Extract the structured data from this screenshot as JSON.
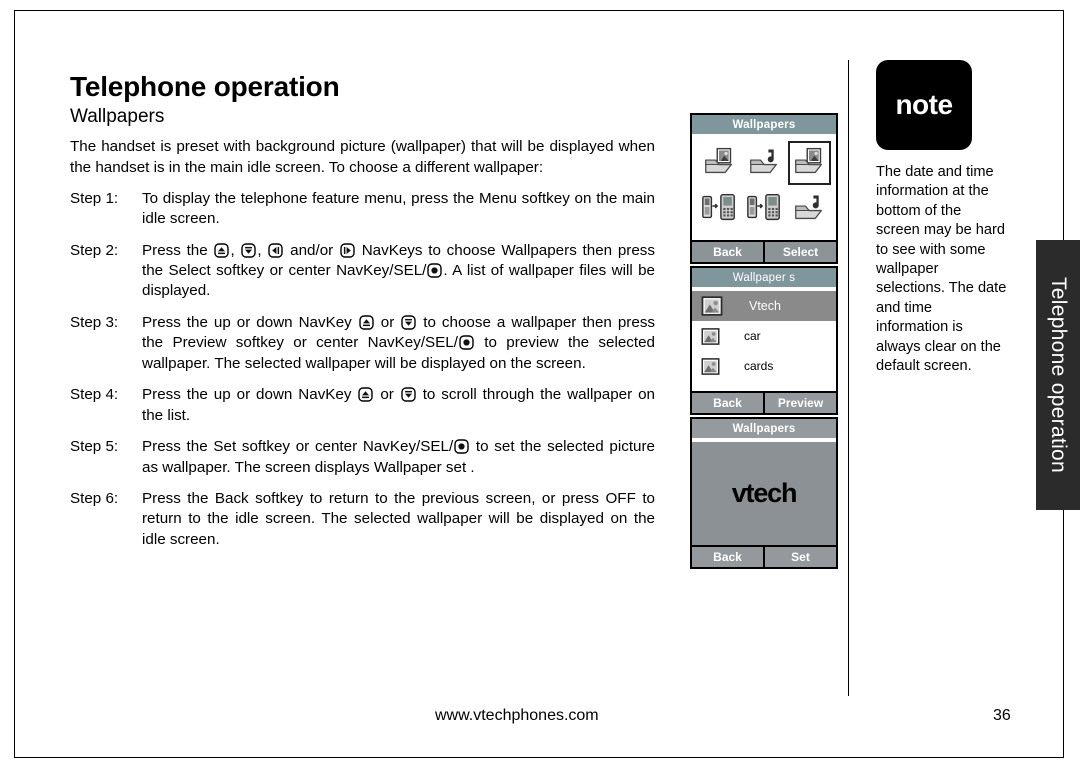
{
  "page": {
    "title": "Telephone operation",
    "section": "Wallpapers",
    "intro": "The handset is preset with background picture (wallpaper) that will be displayed when the handset is in the main idle screen. To choose a different wallpaper:",
    "steps": [
      {
        "label": "Step 1:",
        "parts": [
          {
            "t": "text",
            "v": "To display the telephone feature menu, press the Menu softkey on the main idle screen."
          }
        ]
      },
      {
        "label": "Step 2:",
        "parts": [
          {
            "t": "text",
            "v": "Press the "
          },
          {
            "t": "icon",
            "v": "navkey-up-icon"
          },
          {
            "t": "text",
            "v": ", "
          },
          {
            "t": "icon",
            "v": "navkey-down-icon"
          },
          {
            "t": "text",
            "v": ", "
          },
          {
            "t": "icon",
            "v": "navkey-left-icon"
          },
          {
            "t": "text",
            "v": " and/or "
          },
          {
            "t": "icon",
            "v": "navkey-right-icon"
          },
          {
            "t": "text",
            "v": " NavKeys to choose Wallpapers then press the Select softkey or center NavKey/SEL/"
          },
          {
            "t": "icon",
            "v": "navkey-select-icon"
          },
          {
            "t": "text",
            "v": ". A list of wallpaper files will be displayed."
          }
        ]
      },
      {
        "label": "Step 3:",
        "parts": [
          {
            "t": "text",
            "v": "Press the up or down NavKey "
          },
          {
            "t": "icon",
            "v": "navkey-up-icon"
          },
          {
            "t": "text",
            "v": " or "
          },
          {
            "t": "icon",
            "v": "navkey-down-icon"
          },
          {
            "t": "text",
            "v": " to choose a wallpaper then press the Preview softkey or center NavKey/SEL/"
          },
          {
            "t": "icon",
            "v": "navkey-select-icon"
          },
          {
            "t": "text",
            "v": " to preview the selected wallpaper. The selected wallpaper will be displayed on the screen."
          }
        ]
      },
      {
        "label": "Step 4:",
        "parts": [
          {
            "t": "text",
            "v": "Press the up or down NavKey "
          },
          {
            "t": "icon",
            "v": "navkey-up-icon"
          },
          {
            "t": "text",
            "v": " or "
          },
          {
            "t": "icon",
            "v": "navkey-down-icon"
          },
          {
            "t": "text",
            "v": " to scroll through the wallpaper on the list."
          }
        ]
      },
      {
        "label": "Step 5:",
        "parts": [
          {
            "t": "text",
            "v": "Press the Set softkey or center NavKey/SEL/"
          },
          {
            "t": "icon",
            "v": "navkey-select-icon"
          },
          {
            "t": "text",
            "v": " to set the selected picture as wallpaper. The screen displays Wallpaper set ."
          }
        ]
      },
      {
        "label": "Step 6:",
        "parts": [
          {
            "t": "text",
            "v": "Press the Back softkey to return to the previous screen, or press OFF to return to the idle screen. The selected wallpaper will be displayed on the idle screen."
          }
        ]
      }
    ]
  },
  "screens": [
    {
      "id": "wallpaper-grid",
      "header": "Wallpapers",
      "type": "icon-grid",
      "cells": [
        {
          "icon": "folder-photo-icon",
          "selected": false
        },
        {
          "icon": "folder-music-icon",
          "selected": false
        },
        {
          "icon": "folder-photo-icon",
          "selected": true
        },
        {
          "icon": "basestation-handset-icon",
          "selected": false
        },
        {
          "icon": "basestation-handset-icon",
          "selected": false
        },
        {
          "icon": "folder-music-icon",
          "selected": false
        }
      ],
      "softkeys": [
        "Back",
        "Select"
      ]
    },
    {
      "id": "wallpaper-list",
      "header": "Wallpaper s",
      "type": "list",
      "rows": [
        {
          "icon": "picture-icon",
          "label": "Vtech",
          "selected": true
        },
        {
          "icon": "picture-icon",
          "label": "car",
          "selected": false
        },
        {
          "icon": "picture-icon",
          "label": "cards",
          "selected": false
        }
      ],
      "softkeys": [
        "Back",
        "Preview"
      ]
    },
    {
      "id": "wallpaper-preview",
      "header": "Wallpapers",
      "type": "preview",
      "preview_text": "vtech",
      "softkeys": [
        "Back",
        "Set"
      ]
    }
  ],
  "note": {
    "badge": "note",
    "text": "The date and time information at the bottom of the screen may be hard to see with some wallpaper selections. The date and time information is always clear on the default screen."
  },
  "side_tab": {
    "label": "Telephone operation"
  },
  "footer": {
    "url": "www.vtechphones.com",
    "page_number": "36"
  },
  "colors": {
    "header_teal": "#7e969c",
    "softkey_gray": "#8d9497",
    "list_selected": "#8a8a8a",
    "preview_bg": "#8b9194",
    "side_tab_bg": "#2b2b2b"
  }
}
